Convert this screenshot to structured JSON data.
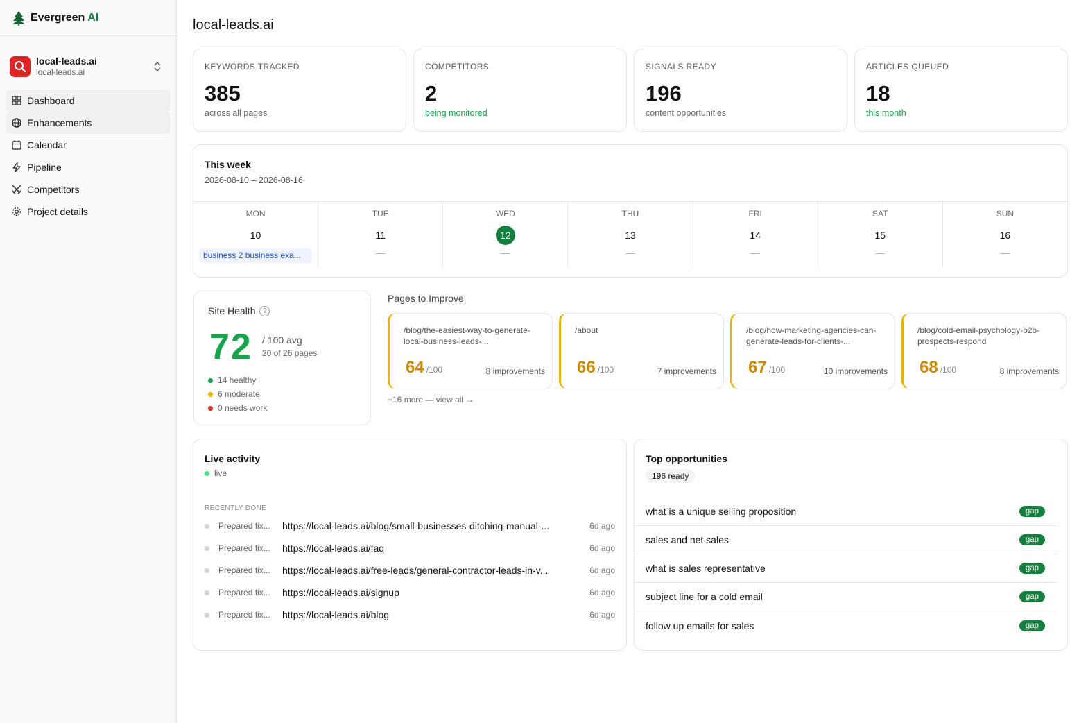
{
  "brand": {
    "name": "Evergreen",
    "accent": "AI"
  },
  "project": {
    "name": "local-leads.ai",
    "domain": "local-leads.ai"
  },
  "nav": [
    {
      "label": "Dashboard",
      "icon": "grid-icon"
    },
    {
      "label": "Enhancements",
      "icon": "globe-icon"
    },
    {
      "label": "Calendar",
      "icon": "calendar-icon"
    },
    {
      "label": "Pipeline",
      "icon": "lightning-icon"
    },
    {
      "label": "Competitors",
      "icon": "swords-icon"
    },
    {
      "label": "Project details",
      "icon": "gear-icon"
    }
  ],
  "page_title": "local-leads.ai",
  "stats": [
    {
      "label": "KEYWORDS TRACKED",
      "value": "385",
      "sub": "across all pages"
    },
    {
      "label": "COMPETITORS",
      "value": "2",
      "sub": "being monitored"
    },
    {
      "label": "SIGNALS READY",
      "value": "196",
      "sub": "content opportunities"
    },
    {
      "label": "ARTICLES QUEUED",
      "value": "18",
      "sub": "this month"
    }
  ],
  "week": {
    "title": "This week",
    "range": "2026-08-10 – 2026-08-16",
    "days": [
      {
        "name": "MON",
        "date": "10",
        "item": "business 2 business exa..."
      },
      {
        "name": "TUE",
        "date": "11",
        "item": "—"
      },
      {
        "name": "WED",
        "date": "12",
        "item": "—"
      },
      {
        "name": "THU",
        "date": "13",
        "item": "—"
      },
      {
        "name": "FRI",
        "date": "14",
        "item": "—"
      },
      {
        "name": "SAT",
        "date": "15",
        "item": "—"
      },
      {
        "name": "SUN",
        "date": "16",
        "item": "—"
      }
    ]
  },
  "health": {
    "title": "Site Health",
    "help": "?",
    "score": "72",
    "avg": "/ 100 avg",
    "pages": "20 of 26 pages",
    "legend": [
      "14 healthy",
      "6 moderate",
      "0 needs work"
    ],
    "colors": [
      "#16a34a",
      "#eab308",
      "#dc2626"
    ]
  },
  "pages_to_improve": {
    "title": "Pages to Improve",
    "items": [
      {
        "path": "/blog/the-easiest-way-to-generate-local-business-leads-...",
        "score": "64",
        "max": "/100",
        "improvements": "8 improvements"
      },
      {
        "path": "/about",
        "score": "66",
        "max": "/100",
        "improvements": "7 improvements"
      },
      {
        "path": "/blog/how-marketing-agencies-can-generate-leads-for-clients-...",
        "score": "67",
        "max": "/100",
        "improvements": "10 improvements"
      },
      {
        "path": "/blog/cold-email-psychology-b2b-prospects-respond",
        "score": "68",
        "max": "/100",
        "improvements": "8 improvements"
      }
    ],
    "more": "+16 more — view all →"
  },
  "activity": {
    "title": "Live activity",
    "live": "live",
    "section": "RECENTLY DONE",
    "rows": [
      {
        "action": "Prepared fix...",
        "url": "https://local-leads.ai/blog/small-businesses-ditching-manual-...",
        "ago": "6d ago"
      },
      {
        "action": "Prepared fix...",
        "url": "https://local-leads.ai/faq",
        "ago": "6d ago"
      },
      {
        "action": "Prepared fix...",
        "url": "https://local-leads.ai/free-leads/general-contractor-leads-in-v...",
        "ago": "6d ago"
      },
      {
        "action": "Prepared fix...",
        "url": "https://local-leads.ai/signup",
        "ago": "6d ago"
      },
      {
        "action": "Prepared fix...",
        "url": "https://local-leads.ai/blog",
        "ago": "6d ago"
      }
    ]
  },
  "opportunities": {
    "title": "Top opportunities",
    "count": "196 ready",
    "rows": [
      {
        "label": "what is a unique selling proposition",
        "tag": "gap"
      },
      {
        "label": "sales and net sales",
        "tag": "gap"
      },
      {
        "label": "what is sales representative",
        "tag": "gap"
      },
      {
        "label": "subject line for a cold email",
        "tag": "gap"
      },
      {
        "label": "follow up emails for sales",
        "tag": "gap"
      }
    ]
  }
}
